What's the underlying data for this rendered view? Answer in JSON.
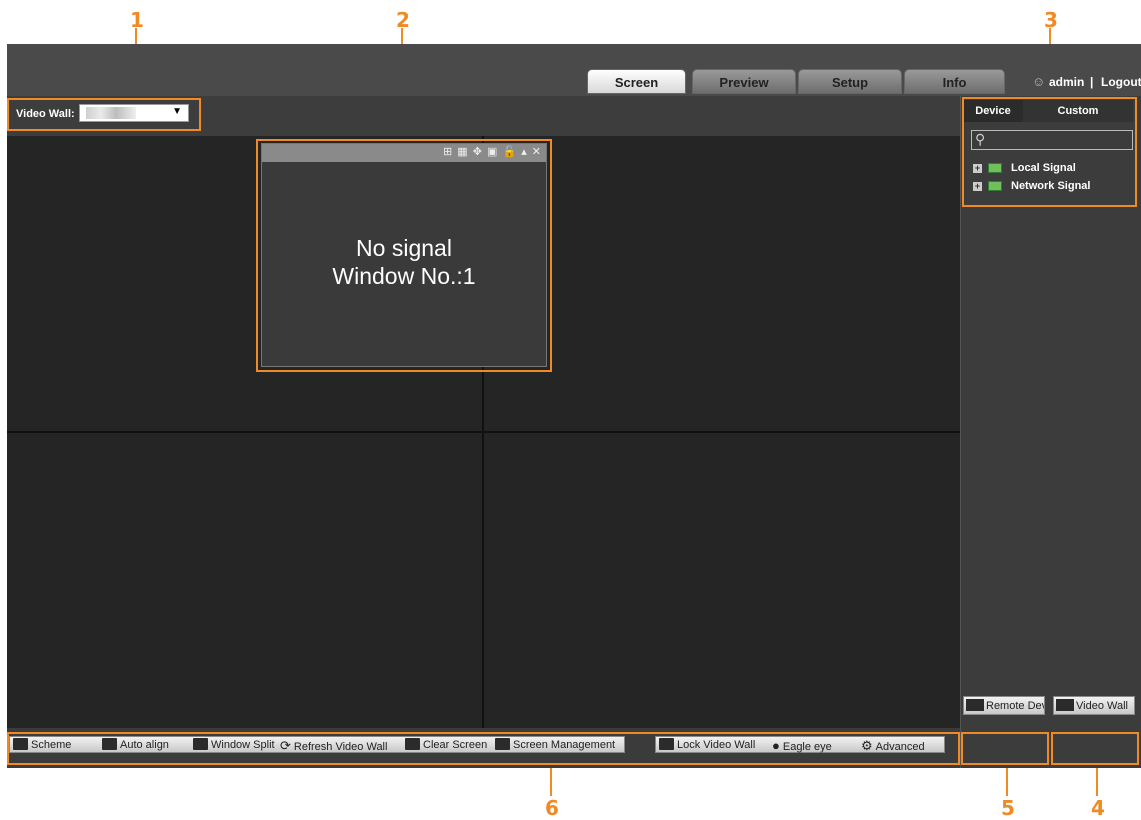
{
  "callouts": [
    "1",
    "2",
    "3",
    "4",
    "5",
    "6"
  ],
  "tabs": [
    "Screen",
    "Preview",
    "Setup",
    "Info"
  ],
  "user": {
    "name": "admin",
    "separator": "|",
    "logout": "Logout"
  },
  "video_wall": {
    "label": "Video Wall:"
  },
  "window": {
    "line1": "No signal",
    "line2": "Window No.:1"
  },
  "panel": {
    "tab_device": "Device",
    "tab_custom": "Custom",
    "tree": [
      "Local Signal",
      "Network Signal"
    ]
  },
  "toolbar": {
    "scheme": "Scheme",
    "auto_align": "Auto align",
    "window_split": "Window Split",
    "refresh": "Refresh Video Wall",
    "clear": "Clear Screen",
    "screen_mgmt": "Screen Management",
    "lock": "Lock Video Wall",
    "eagle": "Eagle eye",
    "advanced": "Advanced"
  },
  "right_buttons": {
    "remote": "Remote Dev",
    "video_wall": "Video Wall"
  },
  "colors": {
    "callout": "#f08a24",
    "background": "#3b3b3b"
  }
}
